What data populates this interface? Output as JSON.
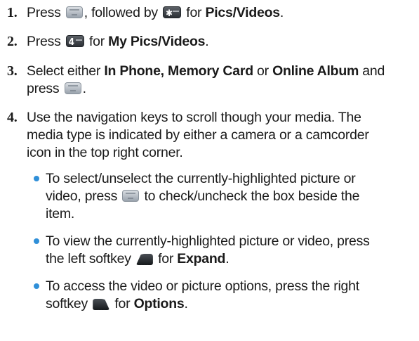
{
  "steps": [
    {
      "number": "1.",
      "parts": {
        "t1": "Press",
        "t2": ", followed by",
        "t3": "for",
        "bold1": "Pics/Videos",
        "end": "."
      }
    },
    {
      "number": "2.",
      "parts": {
        "t1": "Press",
        "t2": "for",
        "bold1": "My Pics/Videos",
        "end": "."
      }
    },
    {
      "number": "3.",
      "parts": {
        "t1": "Select either",
        "bold1": "In Phone, Memory Card",
        "t2": "or",
        "bold2": "Online Album",
        "t3": "and",
        "t4": "press",
        "end": "."
      }
    },
    {
      "number": "4.",
      "lines": [
        "Use the navigation keys to scroll though your media. The",
        "media type is indicated by either a camera or a camcorder",
        "icon in the top right corner."
      ]
    }
  ],
  "bullets": [
    {
      "line1": "To select/unselect the currently-highlighted picture or",
      "line2a": "video, press",
      "line2b": "to check/uncheck the box beside the",
      "line3": "item."
    },
    {
      "line1": "To view the currently-highlighted picture or video, press",
      "line2a": "the left softkey",
      "line2b": "for",
      "bold": "Expand",
      "end": "."
    },
    {
      "line1": "To access the video or picture options, press the right",
      "line2a": "softkey",
      "line2b": "for",
      "bold": "Options",
      "end": "."
    }
  ],
  "icons": {
    "menu_ok_key": "menu-ok-key-icon",
    "star_key": "star-shift-key-icon",
    "four_key": "four-ghi-key-icon",
    "left_softkey": "left-softkey-icon",
    "right_softkey": "right-softkey-icon",
    "star_glyph": "✱",
    "four_glyph": "4",
    "soft_dots": "..."
  },
  "colors": {
    "bullet": "#2f8fd8",
    "text": "#1a1a1a"
  }
}
